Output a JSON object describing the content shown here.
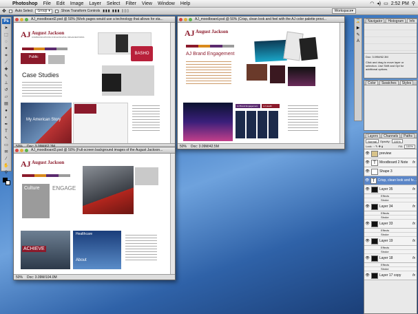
{
  "menubar": {
    "app": "Photoshop",
    "items": [
      "File",
      "Edit",
      "Image",
      "Layer",
      "Select",
      "Filter",
      "View",
      "Window",
      "Help"
    ],
    "clock": "2:52 PM"
  },
  "options": {
    "auto_select": "Auto Select",
    "group": "Group",
    "show_transform": "Show Transform Controls",
    "workspace": "Workspace"
  },
  "doc1": {
    "title": "AJ_moodboard2.psd @ 50% (Work pages would use a technology that allows for sta...",
    "zoom": "50%",
    "status": "Doc: 3.09M/62.3M",
    "brand": "August Jackson",
    "sub": "COMMUNICATIONS FOR EVOLVING ORGANIZATIONS",
    "heading": "Case Studies",
    "aj": "AJ",
    "public": "Public",
    "basho": "BASHO",
    "story": "My American Story"
  },
  "doc2": {
    "title": "AJ_moodboard.psd @ 50% (Crisp, clean look and feel with the AJ color palette provi...",
    "zoom": "50%",
    "status": "Doc: 3.09M/42.5M",
    "brand": "August Jackson",
    "heading": "AJ Brand Engagement",
    "tab1": "AJ Brand Engagement",
    "tab2": "AJ Health",
    "aj": "AJ"
  },
  "doc3": {
    "title": "AJ_moodboard3.psd @ 50% (Full-screen background images of the August Jackson...",
    "zoom": "50%",
    "status": "Doc: 3.09M/104.0M",
    "brand": "August Jackson",
    "culture": "Culture",
    "engage": "ENGAGE",
    "achieve": "ACHIEVE",
    "healthcare": "Healthcare",
    "about": "About",
    "aj": "AJ"
  },
  "info": {
    "tabs": [
      "Navigator",
      "Histogram",
      "Info"
    ],
    "hint": "Click and drag to move layer or selection. Use Shift and Opt for additional options.",
    "doc": "Doc: 3.09M/62.3M"
  },
  "color": {
    "tabs": [
      "Color",
      "Swatches",
      "Styles"
    ]
  },
  "layers": {
    "tabs": [
      "Layers",
      "Channels",
      "Paths"
    ],
    "blend": "Normal",
    "opacity_label": "Opacity:",
    "opacity": "100%",
    "fill_label": "Fill:",
    "fill": "100%",
    "lock_label": "Lock:",
    "items": [
      {
        "name": "preview",
        "kind": "folder"
      },
      {
        "name": "Moodboard 2 Note",
        "kind": "text",
        "fx": "fx"
      },
      {
        "name": "Shape 3",
        "kind": "shape"
      },
      {
        "name": "Crisp, clean look and fe...",
        "kind": "text",
        "selected": true
      },
      {
        "name": "Layer 35",
        "kind": "img",
        "fx": "fx",
        "sub": [
          "Effects",
          "Stroke"
        ]
      },
      {
        "name": "Layer 34",
        "kind": "img",
        "fx": "fx",
        "sub": [
          "Effects",
          "Stroke"
        ]
      },
      {
        "name": "Layer 33",
        "kind": "img",
        "fx": "fx",
        "sub": [
          "Effects",
          "Stroke"
        ]
      },
      {
        "name": "Layer 19",
        "kind": "img",
        "fx": "fx",
        "sub": [
          "Effects",
          "Stroke"
        ]
      },
      {
        "name": "Layer 18",
        "kind": "img",
        "fx": "fx",
        "sub": [
          "Effects",
          "Stroke"
        ]
      },
      {
        "name": "Layer 17 copy",
        "kind": "img",
        "fx": "fx"
      }
    ]
  },
  "colors": {
    "maroon": "#8b1a2b",
    "orange": "#d98a1c",
    "purple": "#5b2a6e",
    "grey": "#9b9b9b"
  }
}
